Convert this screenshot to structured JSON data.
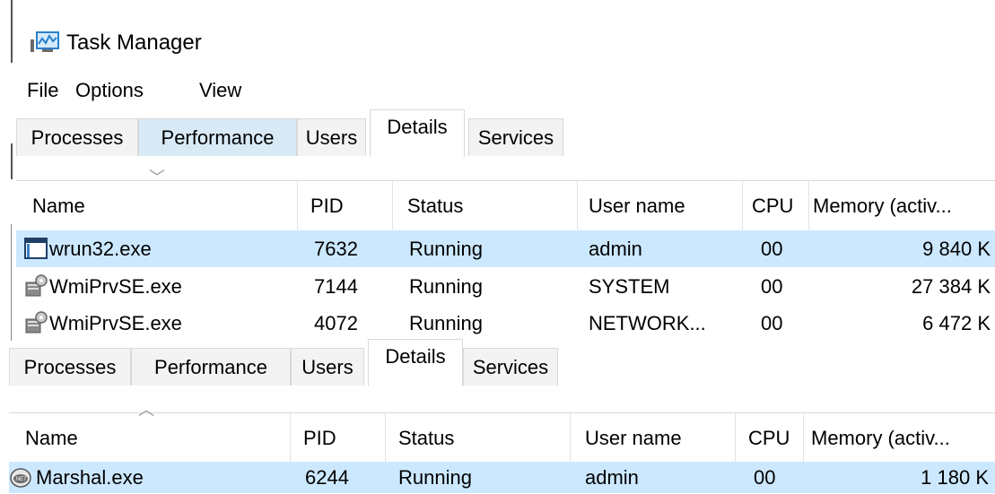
{
  "window": {
    "title": "Task Manager",
    "icon": "task-manager-icon"
  },
  "menu": [
    {
      "label": "File"
    },
    {
      "label": "Options"
    },
    {
      "label": "View"
    }
  ],
  "tabs": [
    {
      "label": "Processes"
    },
    {
      "label": "Performance"
    },
    {
      "label": "Users"
    },
    {
      "label": "Details"
    },
    {
      "label": "Services"
    }
  ],
  "columns": [
    {
      "label": "Name"
    },
    {
      "label": "PID"
    },
    {
      "label": "Status"
    },
    {
      "label": "User name"
    },
    {
      "label": "CPU"
    },
    {
      "label": "Memory (activ..."
    }
  ],
  "panel1": {
    "sort_indicator": "descending",
    "rows": [
      {
        "name": "wrun32.exe",
        "icon": "window-app-icon",
        "pid": "7632",
        "status": "Running",
        "user": "admin",
        "cpu": "00",
        "memory": "9 840 K",
        "selected": true
      },
      {
        "name": "WmiPrvSE.exe",
        "icon": "wmi-service-icon",
        "pid": "7144",
        "status": "Running",
        "user": "SYSTEM",
        "cpu": "00",
        "memory": "27 384 K",
        "selected": false
      },
      {
        "name": "WmiPrvSE.exe",
        "icon": "wmi-service-icon",
        "pid": "4072",
        "status": "Running",
        "user": "NETWORK...",
        "cpu": "00",
        "memory": "6 472 K",
        "selected": false
      }
    ]
  },
  "panel2": {
    "sort_indicator": "ascending",
    "rows": [
      {
        "name": "Marshal.exe",
        "icon": "dotnet-app-icon",
        "pid": "6244",
        "status": "Running",
        "user": "admin",
        "cpu": "00",
        "memory": "1 180 K",
        "selected": true
      }
    ]
  },
  "colors": {
    "selected_row": "#cce8ff",
    "hover_tab": "#d9eaf7",
    "border": "#d9d9d9"
  }
}
